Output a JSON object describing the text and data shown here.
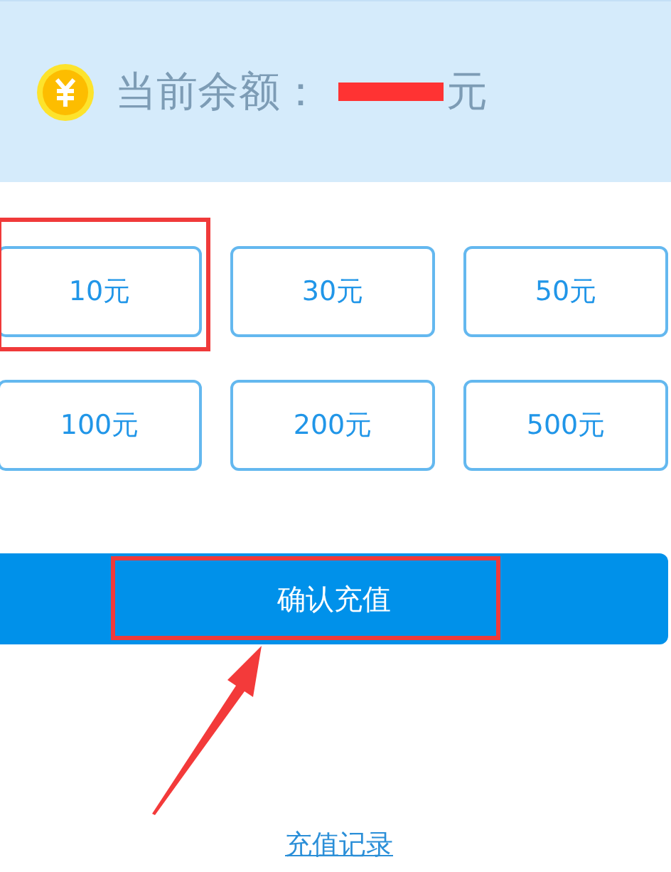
{
  "balance": {
    "label": "当前余额：",
    "unit": "元",
    "redacted": true
  },
  "options": [
    {
      "label": "10元",
      "highlighted": true
    },
    {
      "label": "30元",
      "highlighted": false
    },
    {
      "label": "50元",
      "highlighted": false
    },
    {
      "label": "100元",
      "highlighted": false
    },
    {
      "label": "200元",
      "highlighted": false
    },
    {
      "label": "500元",
      "highlighted": false
    }
  ],
  "confirm_button": {
    "label": "确认充值",
    "highlighted": true
  },
  "history_link": "充值记录"
}
